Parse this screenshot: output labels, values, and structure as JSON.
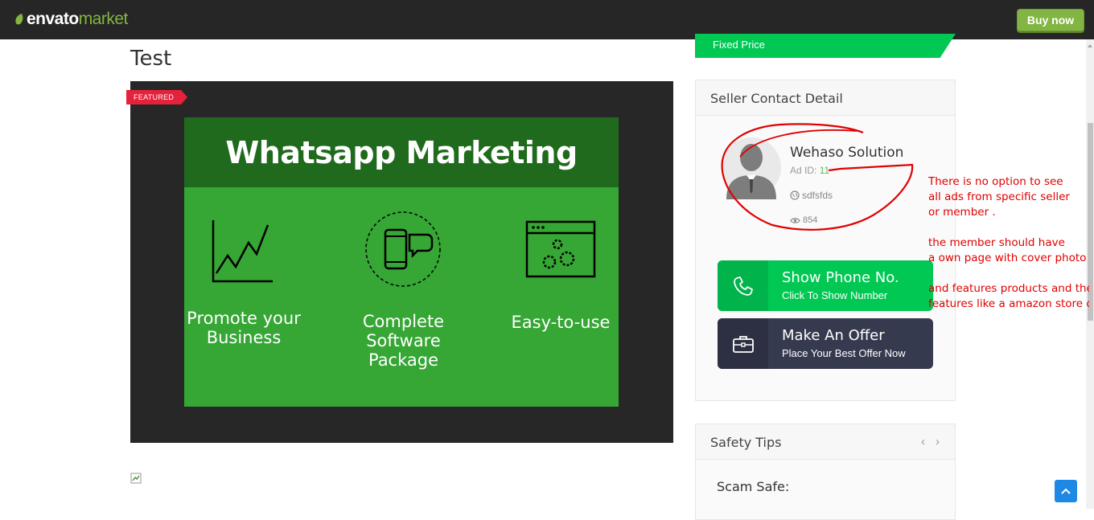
{
  "header": {
    "brand_primary": "envato",
    "brand_secondary": "market",
    "buy_label": "Buy now",
    "brand_color": "#82b541"
  },
  "listing": {
    "title": "Test",
    "featured_label": "FEATURED",
    "promo": {
      "headline": "Whatsapp Marketing",
      "features": [
        {
          "line1": "Promote your",
          "line2": "Business",
          "icon": "line-chart-icon"
        },
        {
          "line1": "Complete Software",
          "line2": "Package",
          "icon": "smartphone-chat-icon"
        },
        {
          "line1": "Easy-to-use",
          "line2": "",
          "icon": "browser-gears-icon"
        }
      ]
    }
  },
  "sidebar": {
    "price_label": "Fixed Price",
    "seller": {
      "heading": "Seller Contact Detail",
      "name": "Wehaso Solution",
      "ad_id_label": "Ad ID:",
      "ad_id": "11",
      "location": "sdfsfds",
      "views": "854"
    },
    "actions": [
      {
        "title": "Show Phone No.",
        "subtitle": "Click To Show Number",
        "icon": "phone-icon"
      },
      {
        "title": "Make An Offer",
        "subtitle": "Place Your Best Offer Now",
        "icon": "briefcase-icon"
      }
    ],
    "safety": {
      "heading": "Safety Tips",
      "item_title": "Scam Safe:"
    }
  },
  "annotation_notes": [
    "There is no option to see",
    "all ads from specific seller",
    "or member .",
    "the member should have",
    " a own page with cover photo",
    "and features products and ther",
    "features like a amazon store or c"
  ],
  "colors": {
    "accent_green": "#00c853",
    "offer_dark": "#363a4e",
    "annotation_red": "#e00000"
  }
}
